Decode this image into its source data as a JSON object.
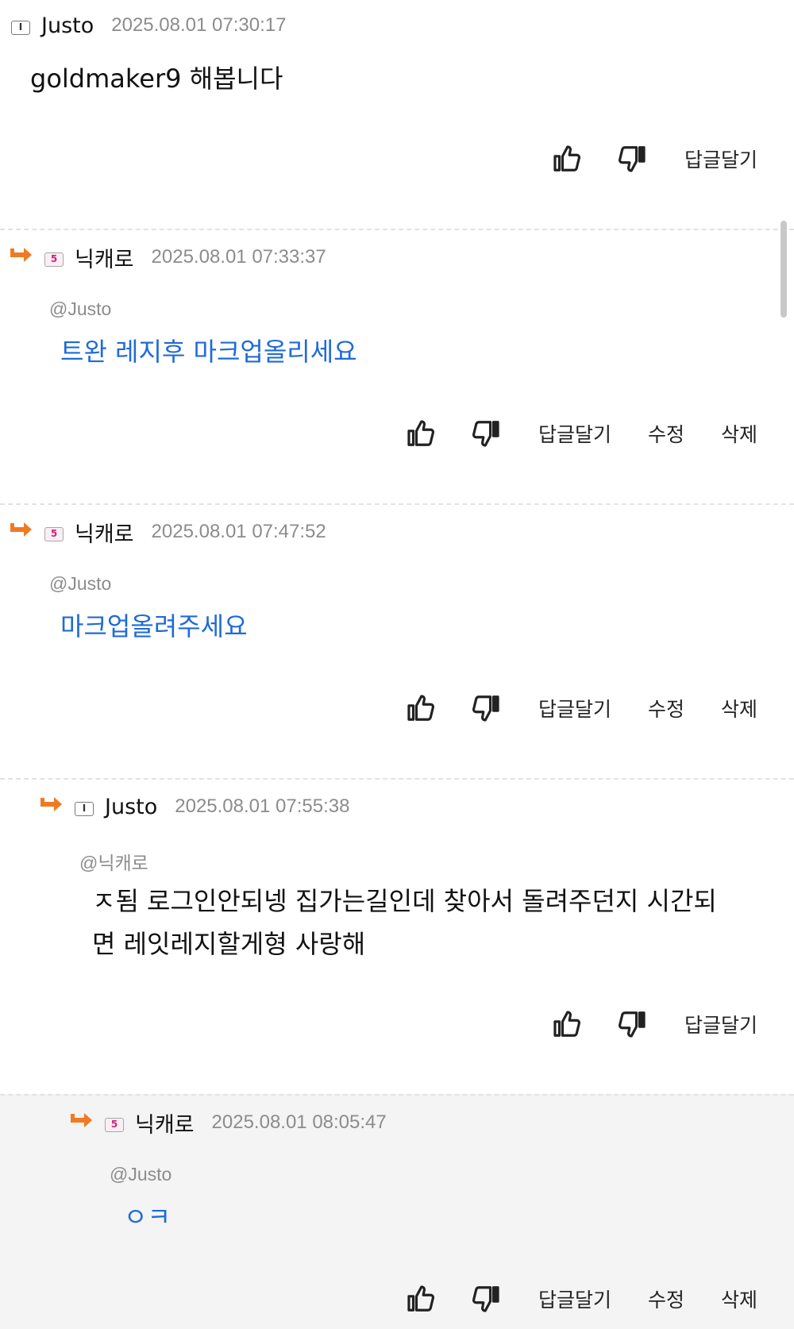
{
  "comments": [
    {
      "nick": "Justo",
      "level": "I",
      "time": "2025.08.01 07:30:17",
      "text": "goldmaker9 해봅니다",
      "actions": [
        "답글달기"
      ]
    },
    {
      "nick": "닉캐로",
      "level": "5",
      "time": "2025.08.01 07:33:37",
      "mention": "@Justo",
      "text": "트완 레지후 마크업올리세요",
      "actions": [
        "답글달기",
        "수정",
        "삭제"
      ]
    },
    {
      "nick": "닉캐로",
      "level": "5",
      "time": "2025.08.01 07:47:52",
      "mention": "@Justo",
      "text": "마크업올려주세요",
      "actions": [
        "답글달기",
        "수정",
        "삭제"
      ]
    },
    {
      "nick": "Justo",
      "level": "I",
      "time": "2025.08.01 07:55:38",
      "mention": "@닉캐로",
      "text_line1": "ㅈ됨 로그인안되넹 집가는길인데 찾아서 돌려주던지 시간되",
      "text_line2": "면 레잇레지할게형 사랑해",
      "actions": [
        "답글달기"
      ]
    },
    {
      "nick": "닉캐로",
      "level": "5",
      "time": "2025.08.01 08:05:47",
      "mention": "@Justo",
      "text": "ㅇㅋ",
      "actions": [
        "답글달기",
        "수정",
        "삭제"
      ]
    }
  ],
  "icons": {
    "like": "thumbs-up-icon",
    "dislike": "thumbs-down-icon",
    "reply_marker": "reply-arrow-icon"
  },
  "colors": {
    "mention_text": "#1f6bd6",
    "reply_arrow": "#f07a23",
    "highlight_bg": "#f4f4f4"
  }
}
